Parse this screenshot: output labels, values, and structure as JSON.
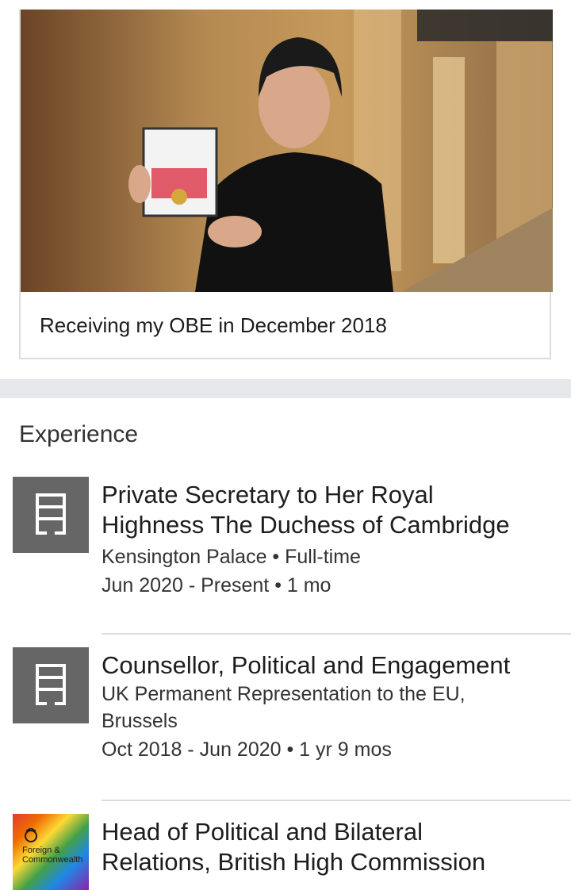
{
  "media": {
    "caption": "Receiving my OBE in December 2018"
  },
  "experience": {
    "section_title": "Experience",
    "items": [
      {
        "title_line1": "Private Secretary to Her Royal",
        "title_line2": "Highness The Duchess of Cambridge",
        "company": "Kensington Palace • Full-time",
        "dates": "Jun 2020 - Present • 1 mo",
        "logo": "building-icon"
      },
      {
        "title_line1": "Counsellor, Political and Engagement",
        "company_line1": "UK Permanent Representation to the EU,",
        "company_line2": "Brussels",
        "dates": "Oct 2018 - Jun 2020 • 1 yr 9 mos",
        "logo": "building-icon"
      },
      {
        "title_line1": "Head of Political and Bilateral",
        "title_line2": "Relations, British High Commission",
        "logo_text": "Foreign & Commonwealth",
        "logo": "foreign-office-rainbow-logo"
      }
    ]
  },
  "colors": {
    "placeholder_logo": "#666666",
    "divider": "#e5e7ea"
  }
}
